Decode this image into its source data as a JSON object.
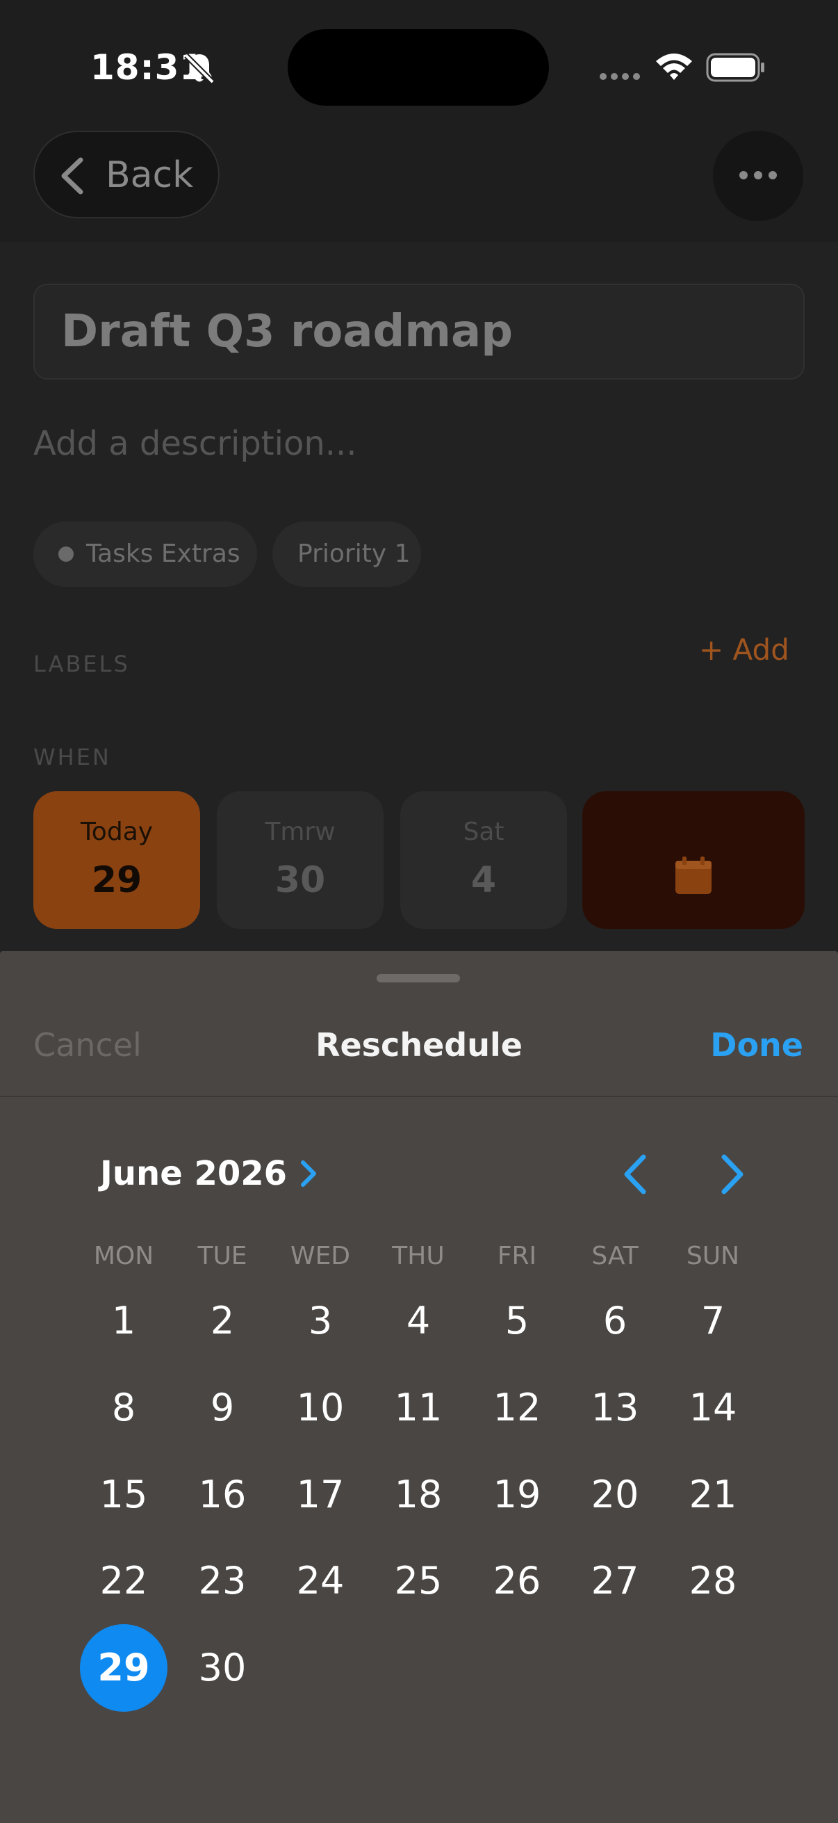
{
  "status_bar": {
    "time": "18:31"
  },
  "nav": {
    "back_label": "Back"
  },
  "task": {
    "title": "Draft Q3 roadmap",
    "description_placeholder": "Add a description...",
    "project_chip": "Tasks Extras",
    "priority_chip": "Priority 1",
    "labels_section": "LABELS",
    "add_label": "+ Add",
    "when_section": "WHEN",
    "date_options": [
      {
        "top": "Today",
        "num": "29"
      },
      {
        "top": "Tmrw",
        "num": "30"
      },
      {
        "top": "Sat",
        "num": "4"
      }
    ]
  },
  "sheet": {
    "cancel_label": "Cancel",
    "title": "Reschedule",
    "done_label": "Done",
    "month_label": "June 2026",
    "weekdays": [
      "MON",
      "TUE",
      "WED",
      "THU",
      "FRI",
      "SAT",
      "SUN"
    ],
    "days": [
      "1",
      "2",
      "3",
      "4",
      "5",
      "6",
      "7",
      "8",
      "9",
      "10",
      "11",
      "12",
      "13",
      "14",
      "15",
      "16",
      "17",
      "18",
      "19",
      "20",
      "21",
      "22",
      "23",
      "24",
      "25",
      "26",
      "27",
      "28",
      "29",
      "30"
    ],
    "selected_day": "29"
  },
  "colors": {
    "accent_blue": "#0f8af0",
    "accent_orange": "#a0541e",
    "today_tile": "#8a4211",
    "sheet_bg": "#4a4643"
  },
  "icons": {
    "status_bell": "bell-slash-icon",
    "status_wifi": "wifi-icon",
    "status_battery": "battery-icon",
    "back": "chevron-left-icon",
    "more": "ellipsis-icon",
    "calendar": "calendar-icon",
    "prev_month": "chevron-left-icon",
    "next_month": "chevron-right-icon"
  }
}
